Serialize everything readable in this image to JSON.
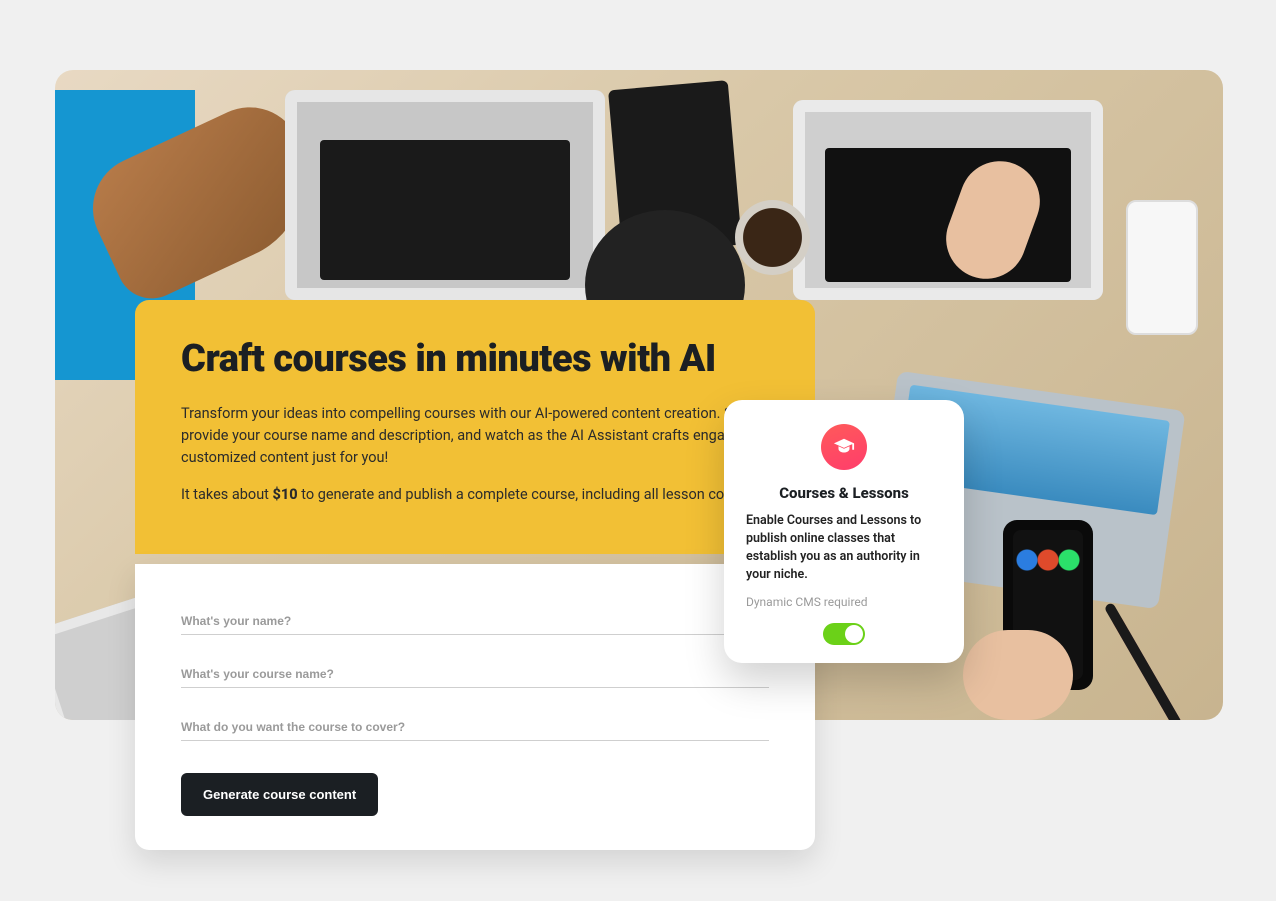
{
  "headline": {
    "title": "Craft courses in minutes with AI",
    "para1": "Transform your ideas into compelling courses with our AI-powered content creation. Simply provide your course name and description, and watch as the AI Assistant crafts engaging, customized content just for you!",
    "cost_prefix": "It takes about ",
    "cost_amount": "$10",
    "cost_suffix": " to generate and publish a complete course, including all lesson content."
  },
  "form": {
    "name_placeholder": "What's your name?",
    "course_placeholder": "What's your course name?",
    "cover_placeholder": "What do you want the course to cover?",
    "button_label": "Generate course content"
  },
  "feature": {
    "title": "Courses & Lessons",
    "desc": "Enable Courses and Lessons to publish online classes that establish you as an authority in your niche.",
    "requirement": "Dynamic CMS required",
    "toggle_on": true
  }
}
